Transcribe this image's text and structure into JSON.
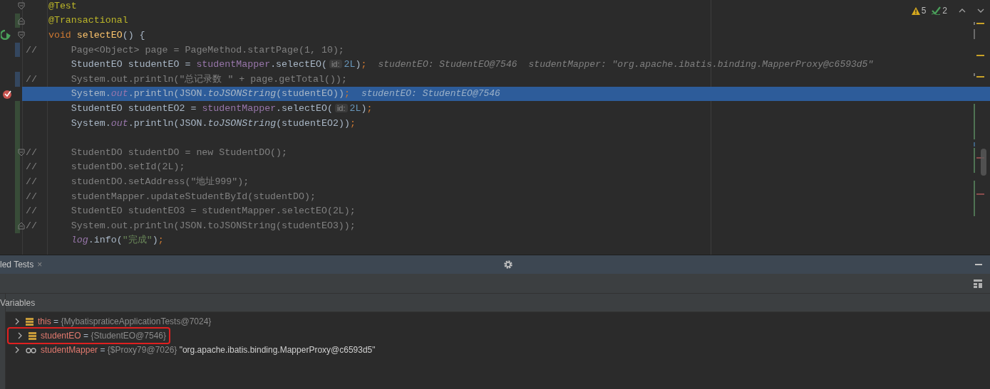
{
  "editor": {
    "inspections": {
      "warnings": "5",
      "weak_warnings": "2"
    },
    "lines": [
      {
        "tokens": [
          {
            "text": "    @Test",
            "kind": "annotation"
          }
        ],
        "fold_start": true
      },
      {
        "tokens": [
          {
            "text": "    @Transactional",
            "kind": "annotation"
          }
        ],
        "fold_end": true,
        "added": true
      },
      {
        "tokens": [
          {
            "text": "    void",
            "kind": "keyword"
          },
          {
            "text": " selectEO",
            "kind": "method"
          },
          {
            "text": "() {",
            "kind": "plain"
          }
        ],
        "fold_start": true,
        "run_marker": true
      },
      {
        "tokens": [
          {
            "text": "//      Page<Object> page = PageMethod.startPage(1, 10);",
            "kind": "comment"
          }
        ],
        "modified": true
      },
      {
        "tokens": [
          {
            "text": "        StudentEO studentEO = ",
            "kind": "plain"
          },
          {
            "text": "studentMapper",
            "kind": "field"
          },
          {
            "text": ".selectEO(",
            "kind": "plain"
          },
          {
            "text": "id:",
            "kind": "hint"
          },
          {
            "text": "2L",
            "kind": "number"
          },
          {
            "text": ")",
            "kind": "plain"
          },
          {
            "text": ";",
            "kind": "keyword"
          }
        ],
        "debug": [
          "studentEO: StudentEO@7546",
          "studentMapper: \"org.apache.ibatis.binding.MapperProxy@c6593d5\""
        ]
      },
      {
        "tokens": [
          {
            "text": "//      System.out.println(\"总记录数 \" + page.getTotal());",
            "kind": "comment"
          }
        ],
        "modified": true
      },
      {
        "tokens": [
          {
            "text": "        System.",
            "kind": "plain"
          },
          {
            "text": "out",
            "kind": "field_static"
          },
          {
            "text": ".println(JSON.",
            "kind": "plain"
          },
          {
            "text": "toJSONString",
            "kind": "static_call"
          },
          {
            "text": "(studentEO))",
            "kind": "plain"
          },
          {
            "text": ";",
            "kind": "keyword"
          }
        ],
        "debug": [
          "studentEO: StudentEO@7546"
        ],
        "selected": true,
        "breakpoint": true
      },
      {
        "tokens": [
          {
            "text": "        StudentEO studentEO2 = ",
            "kind": "plain"
          },
          {
            "text": "studentMapper",
            "kind": "field"
          },
          {
            "text": ".selectEO(",
            "kind": "plain"
          },
          {
            "text": "id:",
            "kind": "hint"
          },
          {
            "text": "2L",
            "kind": "number"
          },
          {
            "text": ")",
            "kind": "plain"
          },
          {
            "text": ";",
            "kind": "keyword"
          }
        ],
        "added": true
      },
      {
        "tokens": [
          {
            "text": "        System.",
            "kind": "plain"
          },
          {
            "text": "out",
            "kind": "field_static"
          },
          {
            "text": ".println(JSON.",
            "kind": "plain"
          },
          {
            "text": "toJSONString",
            "kind": "static_call"
          },
          {
            "text": "(studentEO2))",
            "kind": "plain"
          },
          {
            "text": ";",
            "kind": "keyword"
          }
        ],
        "added": true
      },
      {
        "added": true
      },
      {
        "tokens": [
          {
            "text": "//      StudentDO studentDO = new StudentDO();",
            "kind": "comment"
          }
        ],
        "fold_start": true,
        "added": true
      },
      {
        "tokens": [
          {
            "text": "//      studentDO.setId(2L);",
            "kind": "comment"
          }
        ],
        "added": true
      },
      {
        "tokens": [
          {
            "text": "//      studentDO.setAddress(\"地址999\");",
            "kind": "comment"
          }
        ],
        "added": true
      },
      {
        "tokens": [
          {
            "text": "//      studentMapper.updateStudentById(studentDO);",
            "kind": "comment"
          }
        ],
        "added": true
      },
      {
        "tokens": [
          {
            "text": "//      StudentEO studentEO3 = studentMapper.selectEO(2L);",
            "kind": "comment"
          }
        ],
        "added": true
      },
      {
        "tokens": [
          {
            "text": "//      System.out.println(JSON.toJSONString(studentEO3));",
            "kind": "comment"
          }
        ],
        "fold_end": true,
        "added": true
      },
      {
        "tokens": [
          {
            "text": "        log",
            "kind": "field_static"
          },
          {
            "text": ".info(",
            "kind": "plain"
          },
          {
            "text": "\"完成\"",
            "kind": "string"
          },
          {
            "text": ")",
            "kind": "plain"
          },
          {
            "text": ";",
            "kind": "keyword"
          }
        ]
      }
    ]
  },
  "panel": {
    "tab": {
      "label": "led Tests",
      "close": "×"
    },
    "section": "Variables",
    "variables": [
      {
        "kind": "field",
        "name": "this",
        "equals": "=",
        "value": "{MybatispraticeApplicationTests@7024}",
        "outlined": false
      },
      {
        "kind": "field",
        "name": "studentEO",
        "equals": "=",
        "value": "{StudentEO@7546}",
        "outlined": true
      },
      {
        "kind": "watch",
        "name": "studentMapper",
        "equals": "=",
        "value": "{$Proxy79@7026}",
        "extra": "\"org.apache.ibatis.binding.MapperProxy@c6593d5\"",
        "outlined": false
      }
    ]
  }
}
